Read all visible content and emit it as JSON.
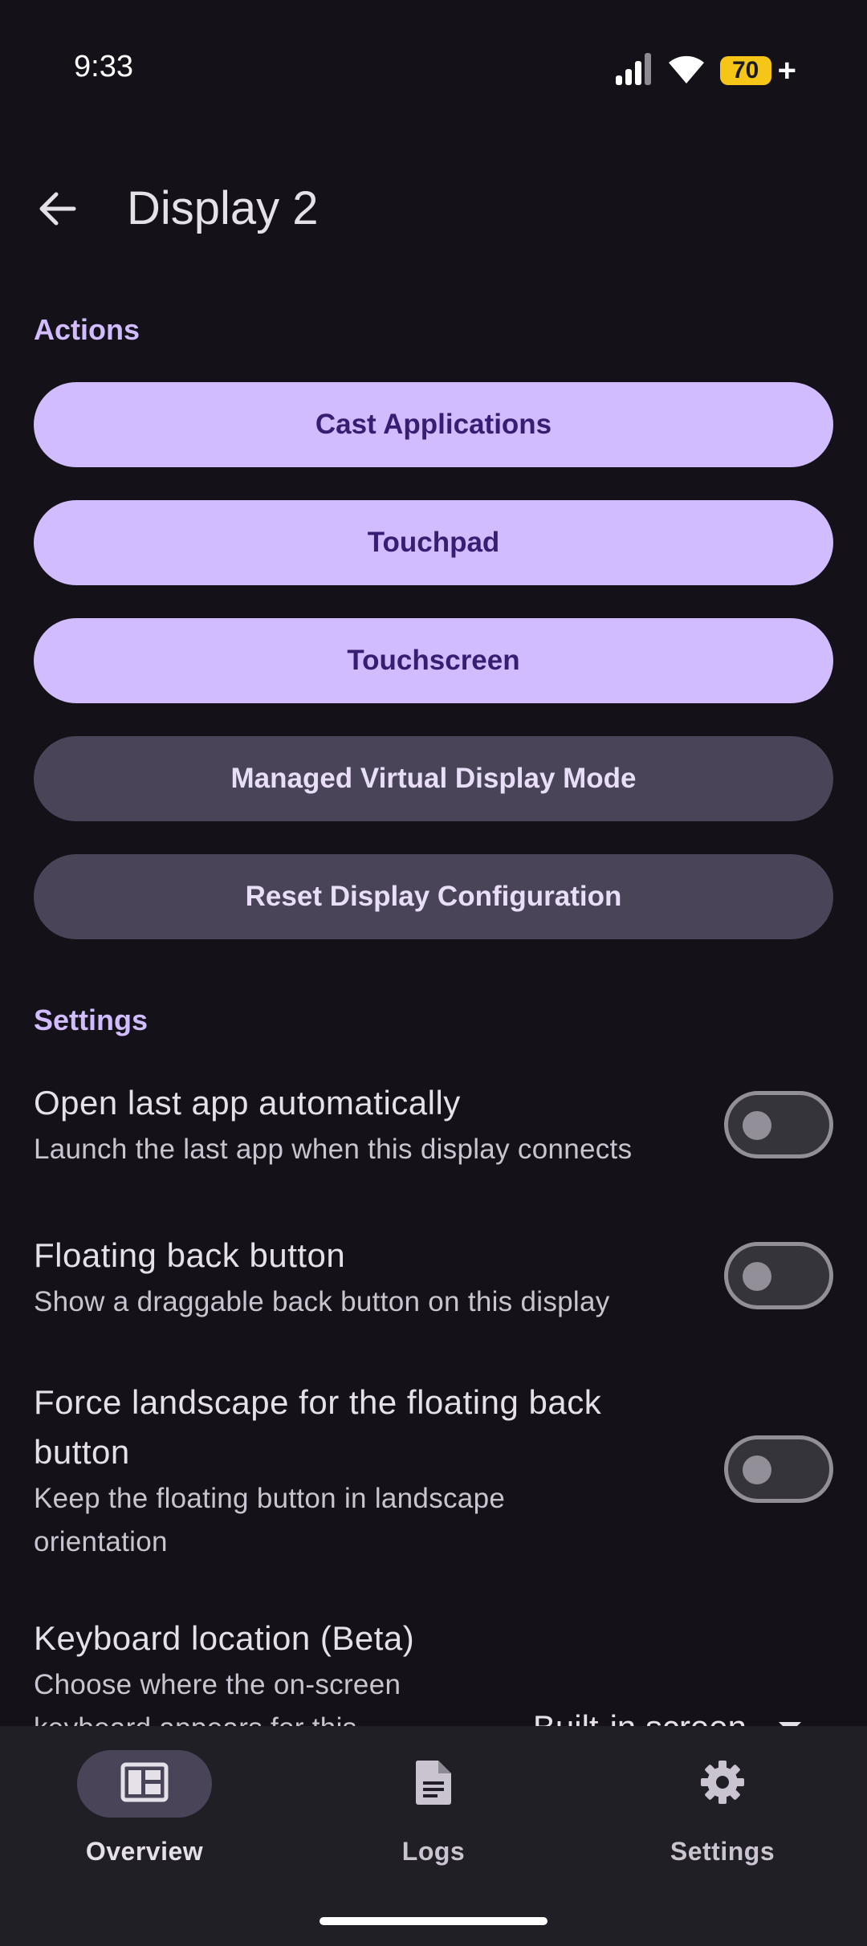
{
  "status_bar": {
    "time": "9:33",
    "battery": "70",
    "battery_suffix": "+"
  },
  "header": {
    "title": "Display 2"
  },
  "actions": {
    "section_label": "Actions",
    "buttons": [
      {
        "label": "Cast Applications",
        "style": "primary"
      },
      {
        "label": "Touchpad",
        "style": "primary"
      },
      {
        "label": "Touchscreen",
        "style": "primary"
      },
      {
        "label": "Managed Virtual Display Mode",
        "style": "tonal"
      },
      {
        "label": "Reset Display Configuration",
        "style": "tonal"
      }
    ]
  },
  "settings": {
    "section_label": "Settings",
    "items": [
      {
        "title": "Open last app automatically",
        "description": "Launch the last app when this display connects",
        "enabled": false
      },
      {
        "title": "Floating back button",
        "description": "Show a draggable back button on this display",
        "enabled": false
      },
      {
        "title": "Force landscape for the floating back button",
        "description": "Keep the floating button in landscape orientation",
        "enabled": false
      },
      {
        "title": "Keyboard location (Beta)",
        "description": "Choose where the on-screen keyboard appears for this",
        "value": "Built-in screen"
      }
    ]
  },
  "bottom_nav": {
    "items": [
      {
        "label": "Overview",
        "icon": "overview-icon",
        "active": true
      },
      {
        "label": "Logs",
        "icon": "document-icon",
        "active": false
      },
      {
        "label": "Settings",
        "icon": "gear-icon",
        "active": false
      }
    ]
  },
  "colors": {
    "background": "#141218",
    "primary": "#D0BCFF",
    "on_primary": "#381E72",
    "tonal": "#4A4458",
    "nav_background": "#211F26",
    "battery": "#F5C518"
  }
}
